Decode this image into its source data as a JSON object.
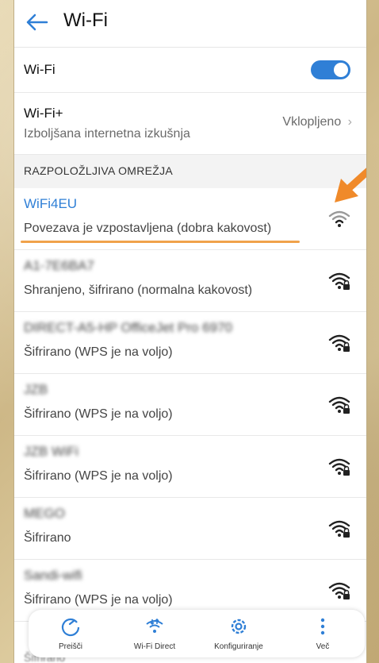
{
  "header": {
    "title": "Wi-Fi"
  },
  "wifi_row": {
    "label": "Wi-Fi",
    "enabled": true
  },
  "wifiplus_row": {
    "label": "Wi-Fi+",
    "sub": "Izboljšana internetna izkušnja",
    "value": "Vklopljeno"
  },
  "section_title": "RAZPOLOŽLJIVA OMREŽJA",
  "networks": [
    {
      "ssid": "WiFi4EU",
      "status": "Povezava je vzpostavljena (dobra kakovost)",
      "locked": false,
      "connected": true
    },
    {
      "ssid": "A1-7E6BA7",
      "status": "Shranjeno, šifrirano (normalna kakovost)",
      "locked": true,
      "connected": false
    },
    {
      "ssid": "DIRECT-A5-HP OfficeJet Pro 6970",
      "status": "Šifrirano (WPS je na voljo)",
      "locked": true,
      "connected": false
    },
    {
      "ssid": "JZB",
      "status": "Šifrirano (WPS je na voljo)",
      "locked": true,
      "connected": false
    },
    {
      "ssid": "JZB WiFi",
      "status": "Šifrirano (WPS je na voljo)",
      "locked": true,
      "connected": false
    },
    {
      "ssid": "MEGO",
      "status": "Šifrirano",
      "locked": true,
      "connected": false
    },
    {
      "ssid": "Sandi-wifi",
      "status": "Šifrirano (WPS je na voljo)",
      "locked": true,
      "connected": false
    }
  ],
  "peek_text": "Šifrirano",
  "bottom_bar": [
    {
      "label": "Preišči",
      "icon": "refresh-icon"
    },
    {
      "label": "Wi-Fi Direct",
      "icon": "wifi-direct-icon"
    },
    {
      "label": "Konfiguriranje",
      "icon": "gear-icon"
    },
    {
      "label": "Več",
      "icon": "more-vertical-icon"
    }
  ],
  "colors": {
    "accent": "#2f7fd6",
    "highlight": "#f0a24b",
    "arrow": "#f08a2a"
  }
}
